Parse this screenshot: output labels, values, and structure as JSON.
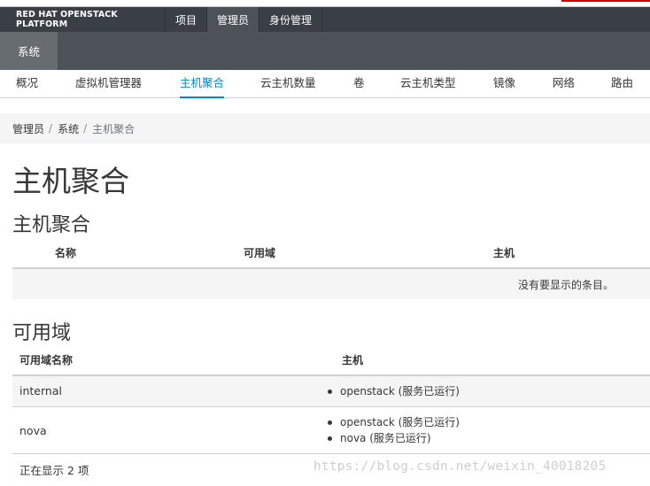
{
  "masthead": {
    "brand": "RED HAT OPENSTACK PLATFORM",
    "tabs": [
      {
        "label": "项目",
        "active": false
      },
      {
        "label": "管理员",
        "active": true
      },
      {
        "label": "身份管理",
        "active": false
      }
    ]
  },
  "subnav": {
    "system": "系统"
  },
  "panel_nav": {
    "items": [
      {
        "label": "概况",
        "active": false
      },
      {
        "label": "虚拟机管理器",
        "active": false
      },
      {
        "label": "主机聚合",
        "active": true
      },
      {
        "label": "云主机数量",
        "active": false
      },
      {
        "label": "卷",
        "active": false
      },
      {
        "label": "云主机类型",
        "active": false
      },
      {
        "label": "镜像",
        "active": false
      },
      {
        "label": "网络",
        "active": false
      },
      {
        "label": "路由",
        "active": false
      }
    ]
  },
  "breadcrumb": {
    "items": [
      "管理员",
      "系统",
      "主机聚合"
    ],
    "separator": "/"
  },
  "page_title": "主机聚合",
  "aggregates": {
    "title": "主机聚合",
    "columns": [
      "名称",
      "可用域",
      "主机"
    ],
    "empty_text": "没有要显示的条目。"
  },
  "zones": {
    "title": "可用域",
    "columns": [
      "可用域名称",
      "主机"
    ],
    "rows": [
      {
        "name": "internal",
        "hosts": [
          "openstack (服务已运行)"
        ]
      },
      {
        "name": "nova",
        "hosts": [
          "openstack (服务已运行)",
          "nova (服务已运行)"
        ]
      }
    ],
    "count_text": "正在显示 2 项"
  },
  "watermark": "https://blog.csdn.net/weixin_40018205",
  "colors": {
    "masthead_bg": "#393f44",
    "subbar_bg": "#4d5258",
    "active_accent": "#0088ce"
  }
}
